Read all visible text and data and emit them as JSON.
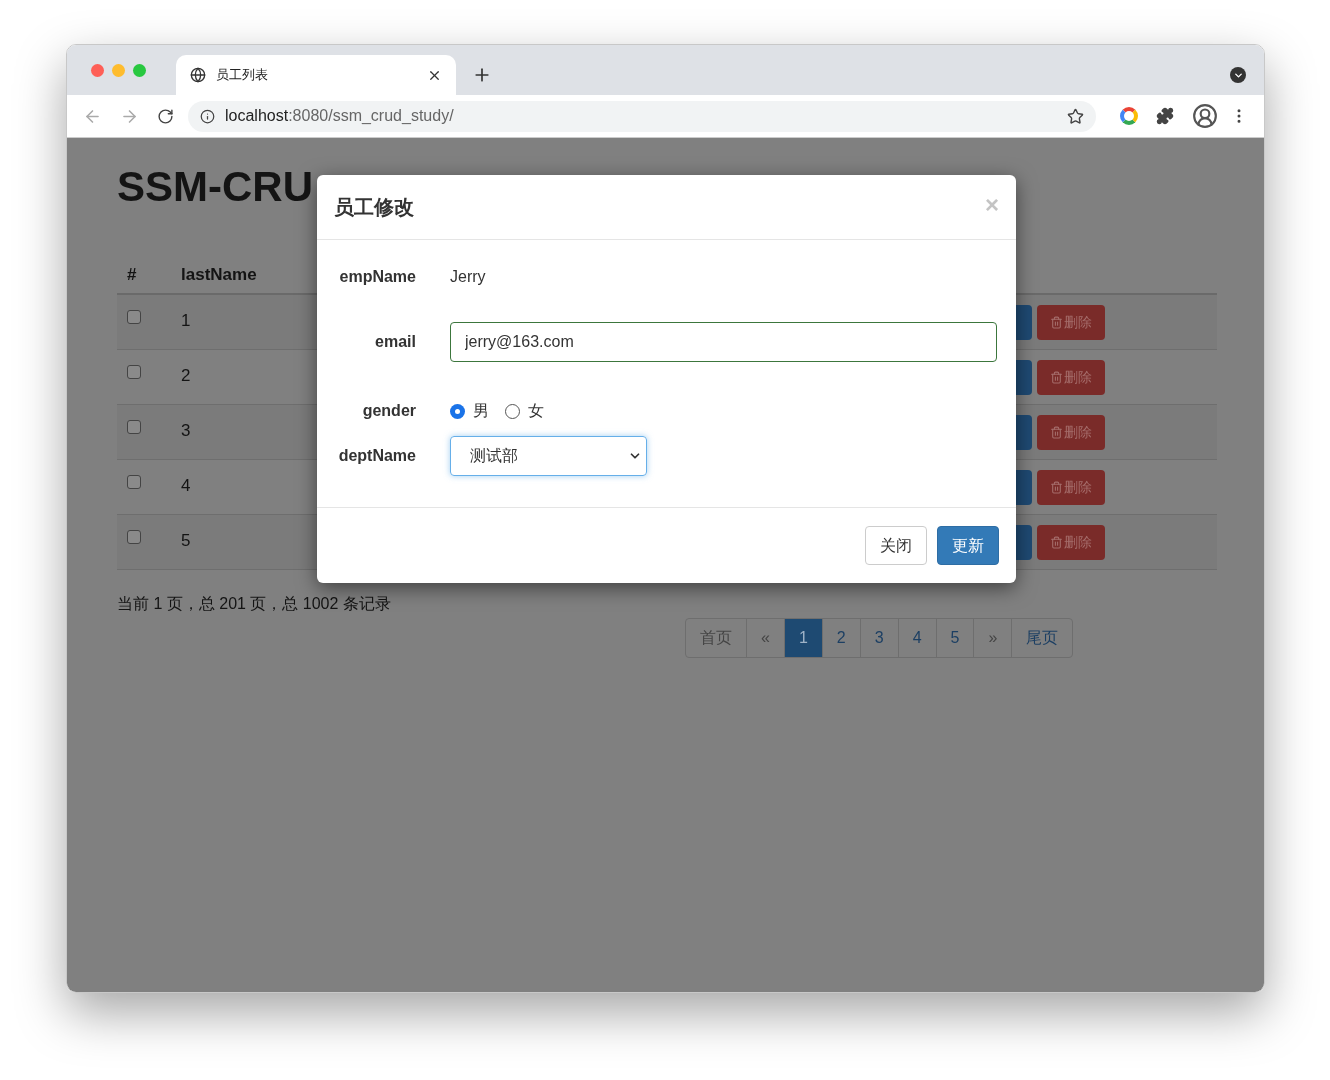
{
  "browser": {
    "tab_title": "员工列表",
    "url_host": "localhost",
    "url_path": ":8080/ssm_crud_study/"
  },
  "page": {
    "title": "SSM-CRU",
    "table": {
      "columns": [
        "#",
        "lastName"
      ],
      "rows": [
        {
          "checked": false,
          "number": "1",
          "delete": "删除"
        },
        {
          "checked": false,
          "number": "2",
          "delete": "删除"
        },
        {
          "checked": false,
          "number": "3",
          "delete": "删除"
        },
        {
          "checked": false,
          "number": "4",
          "delete": "删除"
        },
        {
          "checked": false,
          "number": "5",
          "delete": "删除"
        }
      ]
    },
    "page_info": "当前 1 页，总 201 页，总 1002 条记录",
    "pagination": [
      {
        "label": "首页",
        "selected": false
      },
      {
        "label": "«",
        "selected": false
      },
      {
        "label": "1",
        "selected": true
      },
      {
        "label": "2",
        "selected": false
      },
      {
        "label": "3",
        "selected": false
      },
      {
        "label": "4",
        "selected": false
      },
      {
        "label": "5",
        "selected": false
      },
      {
        "label": "»",
        "selected": false
      },
      {
        "label": "尾页",
        "selected": false
      }
    ]
  },
  "modal": {
    "title": "员工修改",
    "close": "×",
    "emp_name_label": "empName",
    "emp_name": "Jerry",
    "email_label": "email",
    "email": "jerry@163.com",
    "gender_label": "gender",
    "genders": [
      {
        "label": "男",
        "selected": true
      },
      {
        "label": "女",
        "selected": false
      }
    ],
    "dept_label": "deptName",
    "dept": "测试部",
    "buttons": [
      {
        "kind": "default",
        "label": "关闭"
      },
      {
        "kind": "primary",
        "label": "更新"
      }
    ]
  }
}
